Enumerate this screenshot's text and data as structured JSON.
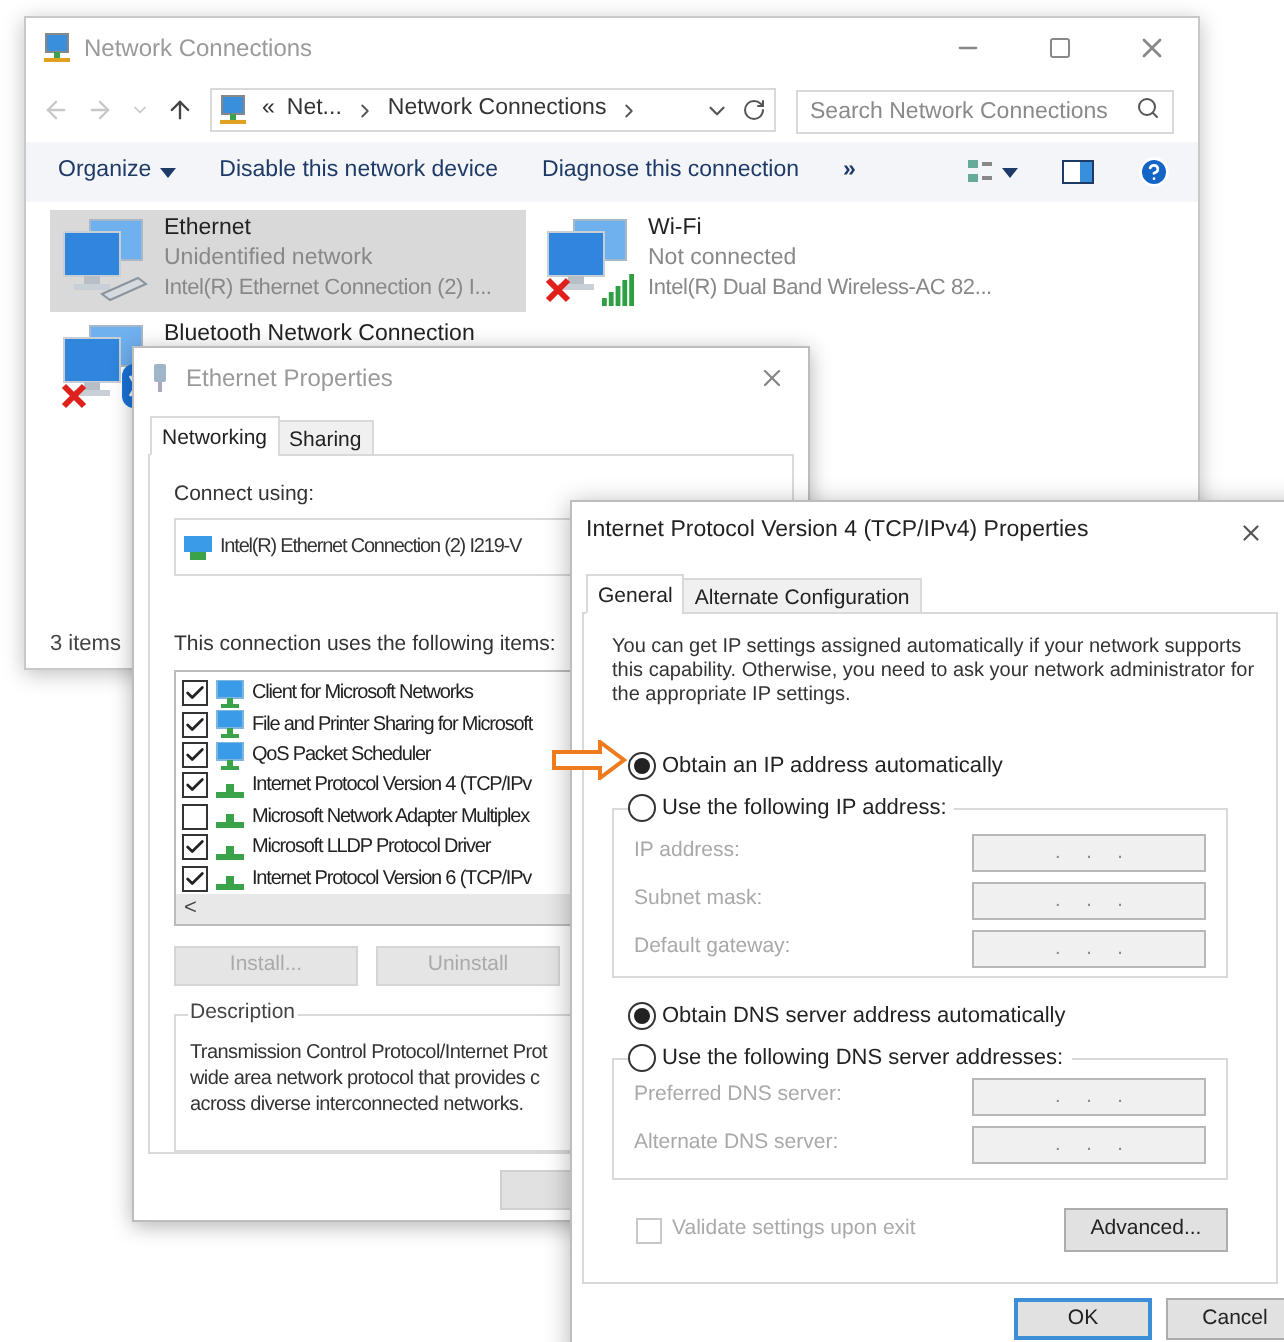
{
  "explorer": {
    "title": "Network Connections",
    "breadcrumb": [
      "«",
      "Net...",
      "Network Connections"
    ],
    "search": {
      "placeholder": "Search Network Connections"
    },
    "toolbar": [
      {
        "label": "Organize",
        "kind": "menu"
      },
      {
        "label": "Disable this network device",
        "kind": "command"
      },
      {
        "label": "Diagnose this connection",
        "kind": "command"
      },
      {
        "label": "»",
        "kind": "more"
      }
    ],
    "connections": [
      {
        "name": "Ethernet",
        "status": "Unidentified network",
        "adapter": "Intel(R) Ethernet Connection (2) I...",
        "selected": true,
        "kind": "wired",
        "disconnected": false
      },
      {
        "name": "Wi-Fi",
        "status": "Not connected",
        "adapter": "Intel(R) Dual Band Wireless-AC 82...",
        "selected": false,
        "kind": "wireless",
        "disconnected": true
      },
      {
        "name": "Bluetooth Network Connection",
        "selected": false,
        "kind": "bluetooth",
        "disconnected": true
      }
    ],
    "status_bar": "3 items"
  },
  "ethernet_properties": {
    "title": "Ethernet Properties",
    "tabs": [
      {
        "label": "Networking",
        "selected": true
      },
      {
        "label": "Sharing",
        "selected": false
      }
    ],
    "connect_using_label": "Connect using:",
    "adapter": "Intel(R) Ethernet Connection (2) I219-V",
    "items_label": "This connection uses the following items:",
    "items": [
      {
        "label": "Client for Microsoft Networks",
        "checked": true,
        "kind": "client"
      },
      {
        "label": "File and Printer Sharing for Microsoft",
        "checked": true,
        "kind": "client"
      },
      {
        "label": "QoS Packet Scheduler",
        "checked": true,
        "kind": "client"
      },
      {
        "label": "Internet Protocol Version 4 (TCP/IPv",
        "checked": true,
        "kind": "protocol"
      },
      {
        "label": "Microsoft Network Adapter Multiplex",
        "checked": false,
        "kind": "protocol"
      },
      {
        "label": "Microsoft LLDP Protocol Driver",
        "checked": true,
        "kind": "protocol"
      },
      {
        "label": "Internet Protocol Version 6 (TCP/IPv",
        "checked": true,
        "kind": "protocol"
      }
    ],
    "scroll_left": "<",
    "buttons": [
      {
        "label": "Install...",
        "disabled": true
      },
      {
        "label": "Uninstall",
        "disabled": true
      }
    ],
    "description_label": "Description",
    "description_lines": [
      "Transmission Control Protocol/Internet Prot",
      "wide area network protocol that provides c",
      "across diverse interconnected networks."
    ]
  },
  "ipv4_properties": {
    "title": "Internet Protocol Version 4 (TCP/IPv4) Properties",
    "tabs": [
      {
        "label": "General",
        "selected": true
      },
      {
        "label": "Alternate Configuration",
        "selected": false
      }
    ],
    "intro": "You can get IP settings assigned automatically if your network supports this capability. Otherwise, you need to ask your network administrator for the appropriate IP settings.",
    "ip_mode": [
      {
        "label": "Obtain an IP address automatically",
        "selected": true
      },
      {
        "label": "Use the following IP address:",
        "selected": false
      }
    ],
    "ip_fields": [
      {
        "label": "IP address:",
        "value": ". . .",
        "disabled": true
      },
      {
        "label": "Subnet mask:",
        "value": ". . .",
        "disabled": true
      },
      {
        "label": "Default gateway:",
        "value": ". . .",
        "disabled": true
      }
    ],
    "dns_mode": [
      {
        "label": "Obtain DNS server address automatically",
        "selected": true
      },
      {
        "label": "Use the following DNS server addresses:",
        "selected": false
      }
    ],
    "dns_fields": [
      {
        "label": "Preferred DNS server:",
        "value": ". . .",
        "disabled": true
      },
      {
        "label": "Alternate DNS server:",
        "value": ". . .",
        "disabled": true
      }
    ],
    "validate": {
      "label": "Validate settings upon exit",
      "checked": false,
      "disabled": true
    },
    "advanced_button": "Advanced...",
    "ok_button": "OK",
    "cancel_button": "Cancel"
  }
}
